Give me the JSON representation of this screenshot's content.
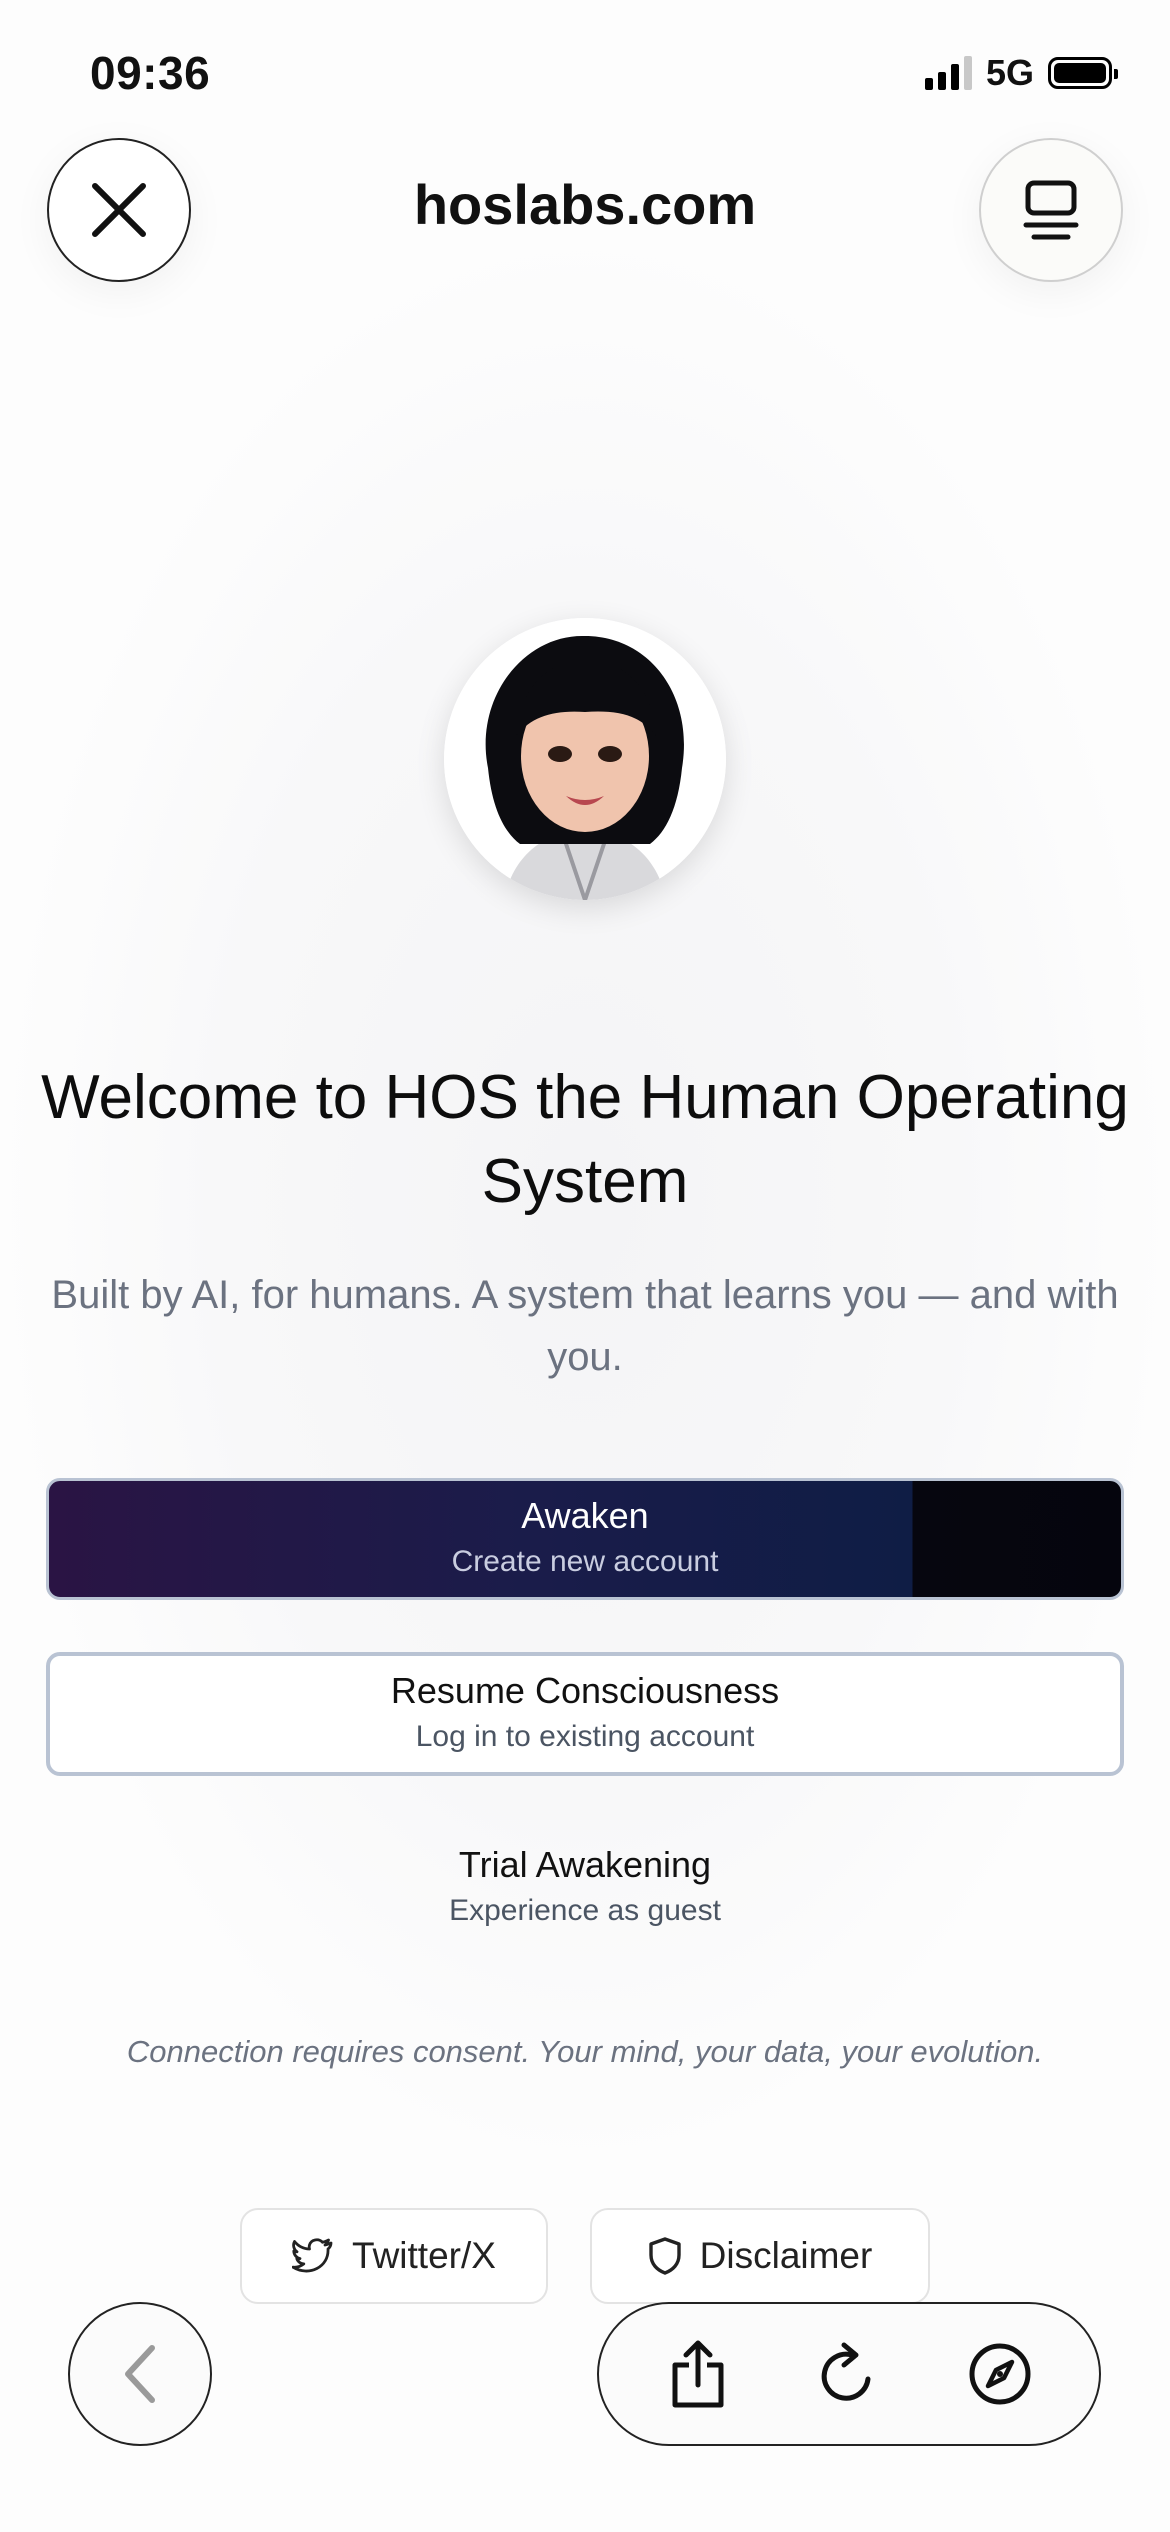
{
  "status_bar": {
    "time": "09:36",
    "network": "5G"
  },
  "header": {
    "url": "hoslabs.com",
    "close_icon": "close-icon",
    "tabs_icon": "tabs-icon"
  },
  "hero": {
    "title": "Welcome to HOS the Human Operating System",
    "subtitle": "Built by AI, for humans. A system that learns you — and with you."
  },
  "actions": {
    "primary": {
      "label": "Awaken",
      "sublabel": "Create new account"
    },
    "secondary": {
      "label": "Resume Consciousness",
      "sublabel": "Log in to existing account"
    },
    "tertiary": {
      "label": "Trial Awakening",
      "sublabel": "Experience as guest"
    }
  },
  "consent_text": "Connection requires consent. Your mind, your data, your evolution.",
  "footer_links": [
    {
      "label": "Twitter/X",
      "icon": "twitter-icon"
    },
    {
      "label": "Disclaimer",
      "icon": "shield-icon"
    }
  ],
  "browser_controls": {
    "back_icon": "chevron-left-icon",
    "share_icon": "share-icon",
    "reload_icon": "reload-icon",
    "compass_icon": "compass-icon"
  },
  "colors": {
    "primary_gradient_start": "#2a1444",
    "primary_gradient_end": "#0f1d45",
    "button_border": "#b9c3d3",
    "muted_text": "#6b7280"
  }
}
